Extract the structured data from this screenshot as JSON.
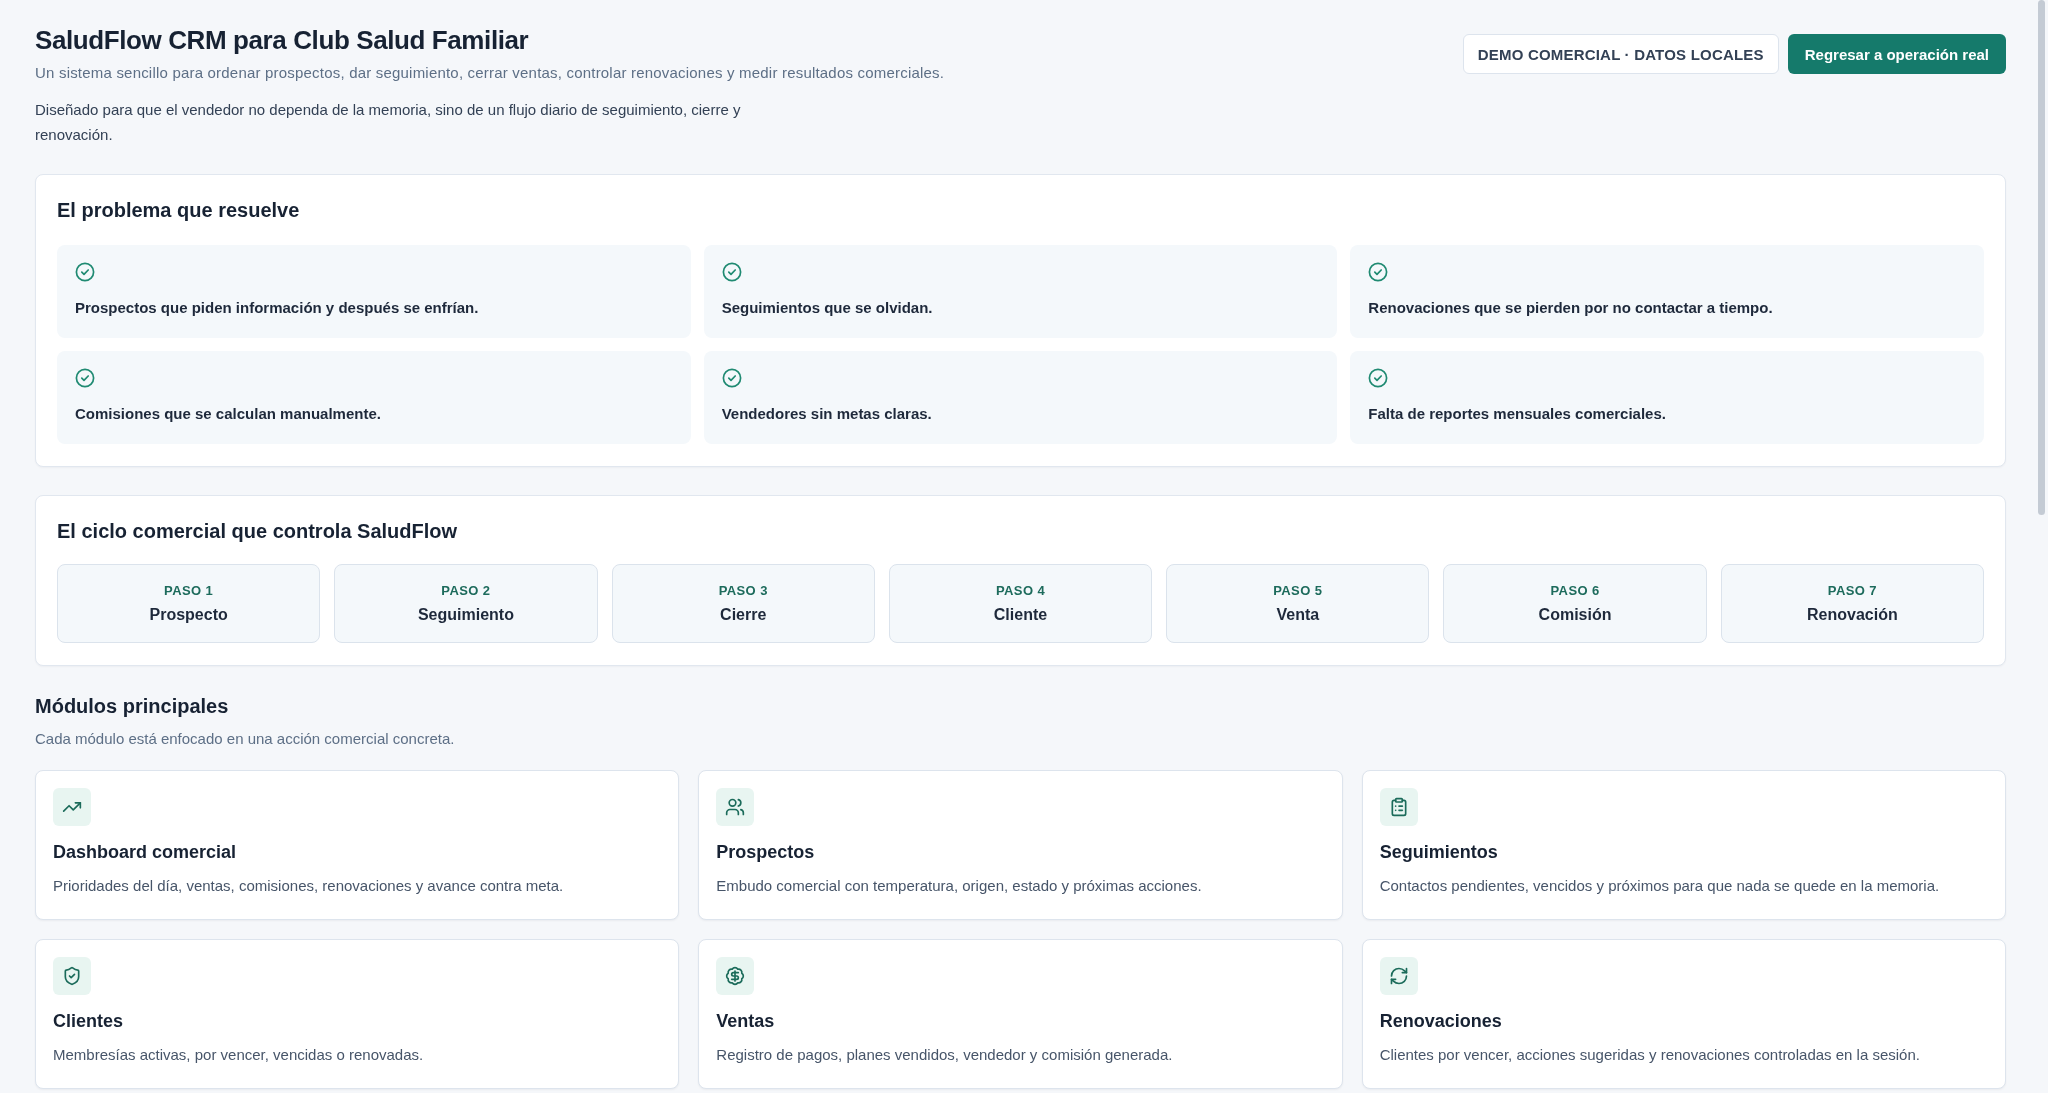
{
  "header": {
    "title": "SaludFlow CRM para Club Salud Familiar",
    "subtitle": "Un sistema sencillo para ordenar prospectos, dar seguimiento, cerrar ventas, controlar renovaciones y medir resultados comerciales.",
    "description": "Diseñado para que el vendedor no dependa de la memoria, sino de un flujo diario de seguimiento, cierre y renovación.",
    "badge": "DEMO COMERCIAL · DATOS LOCALES",
    "button": "Regresar a operación real"
  },
  "problems": {
    "title": "El problema que resuelve",
    "items": [
      "Prospectos que piden información y después se enfrían.",
      "Seguimientos que se olvidan.",
      "Renovaciones que se pierden por no contactar a tiempo.",
      "Comisiones que se calculan manualmente.",
      "Vendedores sin metas claras.",
      "Falta de reportes mensuales comerciales."
    ]
  },
  "cycle": {
    "title": "El ciclo comercial que controla SaludFlow",
    "steps": [
      {
        "number": "PASO 1",
        "name": "Prospecto"
      },
      {
        "number": "PASO 2",
        "name": "Seguimiento"
      },
      {
        "number": "PASO 3",
        "name": "Cierre"
      },
      {
        "number": "PASO 4",
        "name": "Cliente"
      },
      {
        "number": "PASO 5",
        "name": "Venta"
      },
      {
        "number": "PASO 6",
        "name": "Comisión"
      },
      {
        "number": "PASO 7",
        "name": "Renovación"
      }
    ]
  },
  "modules": {
    "title": "Módulos principales",
    "subtitle": "Cada módulo está enfocado en una acción comercial concreta.",
    "items": [
      {
        "title": "Dashboard comercial",
        "description": "Prioridades del día, ventas, comisiones, renovaciones y avance contra meta."
      },
      {
        "title": "Prospectos",
        "description": "Embudo comercial con temperatura, origen, estado y próximas acciones."
      },
      {
        "title": "Seguimientos",
        "description": "Contactos pendientes, vencidos y próximos para que nada se quede en la memoria."
      },
      {
        "title": "Clientes",
        "description": "Membresías activas, por vencer, vencidas o renovadas."
      },
      {
        "title": "Ventas",
        "description": "Registro de pagos, planes vendidos, vendedor y comisión generada."
      },
      {
        "title": "Renovaciones",
        "description": "Clientes por vencer, acciones sugeridas y renovaciones controladas en la sesión."
      }
    ]
  }
}
